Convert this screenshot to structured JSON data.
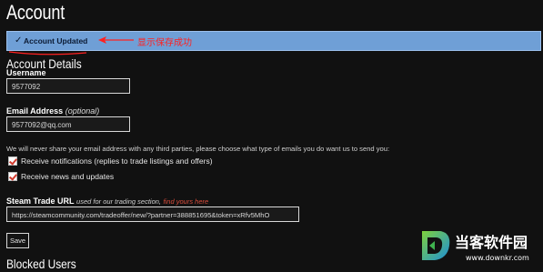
{
  "page": {
    "title": "Account"
  },
  "banner": {
    "check": "✓",
    "message": "Account Updated"
  },
  "annotation": {
    "text": "显示保存成功",
    "color": "#ff2020"
  },
  "details": {
    "section_title": "Account Details",
    "username_label": "Username",
    "username_value": "9577092",
    "email_label": "Email Address",
    "email_optional": "(optional)",
    "email_value": "9577092@qq.com",
    "email_note": "We will never share your email address with any third parties, please choose what type of emails you do want us to send you:",
    "checkboxes": [
      {
        "label": "Receive notifications (replies to trade listings and offers)",
        "checked": true
      },
      {
        "label": "Receive news and updates",
        "checked": true
      }
    ]
  },
  "trade": {
    "label": "Steam Trade URL",
    "hint": "used for our trading section,",
    "link": "find yours here",
    "value": "https://steamcommunity.com/tradeoffer/new/?partner=388851695&token=xRfv5MhO"
  },
  "actions": {
    "save": "Save"
  },
  "blocked": {
    "title": "Blocked Users"
  },
  "watermark": {
    "brand": "当客软件园",
    "url": "www.downkr.com"
  },
  "colors": {
    "banner": "#6f9fd6",
    "link": "#d94c3b",
    "background": "#111111"
  }
}
